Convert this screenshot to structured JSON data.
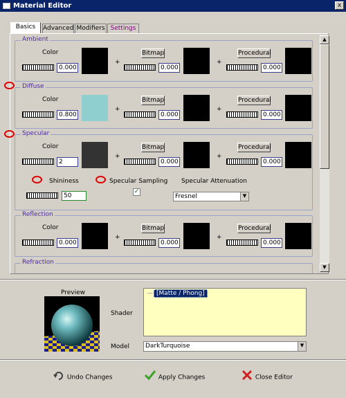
{
  "window": {
    "title": "Material Editor",
    "close_label": "x"
  },
  "tabs": [
    {
      "label": "Basics",
      "active": true
    },
    {
      "label": "Advanced"
    },
    {
      "label": "Modifiers"
    },
    {
      "label": "Settings"
    }
  ],
  "common": {
    "color_label": "Color",
    "bitmap_label": "Bitmap",
    "procedural_label": "Procedural",
    "plus": "+"
  },
  "ambient": {
    "title": "Ambient",
    "color_value": "0.000",
    "bitmap_value": "0.000",
    "procedural_value": "0.000",
    "swatch_color": "#000000"
  },
  "diffuse": {
    "title": "Diffuse",
    "color_value": "0.800",
    "bitmap_value": "0.000",
    "procedural_value": "0.000",
    "swatch_color": "#8fcfd0"
  },
  "specular": {
    "title": "Specular",
    "color_value": "2",
    "bitmap_value": "0.000",
    "procedural_value": "0.000",
    "swatch_color": "#333333",
    "shininess_label": "Shininess",
    "shininess_value": "50",
    "sampling_label": "Specular Sampling",
    "sampling_checked": true,
    "checkmark": "✓",
    "attenuation_label": "Specular Attenuation",
    "attenuation_value": "Fresnel"
  },
  "reflection": {
    "title": "Reflection",
    "color_value": "0.000",
    "bitmap_value": "0.000",
    "procedural_value": "0.000"
  },
  "refraction": {
    "title": "Refraction"
  },
  "preview": {
    "label": "Preview"
  },
  "shader": {
    "label": "Shader",
    "tree_prefix": "—",
    "selected_item": "[Matte / Phong]"
  },
  "model": {
    "label": "Model",
    "value": "DarkTurquoise"
  },
  "actions": {
    "undo": {
      "label": "Undo Changes",
      "icon": "undo-arrow-icon"
    },
    "apply": {
      "label": "Apply Changes",
      "icon": "green-check-icon"
    },
    "close": {
      "label": "Close Editor",
      "icon": "red-x-icon"
    }
  },
  "colors": {
    "title_bar": "#0a246a",
    "group_title": "#4a2aa0",
    "highlight_circle": "#e00000",
    "shader_bg": "#ffffc0"
  },
  "scroll_arrows": {
    "up": "▲",
    "down": "▼"
  }
}
